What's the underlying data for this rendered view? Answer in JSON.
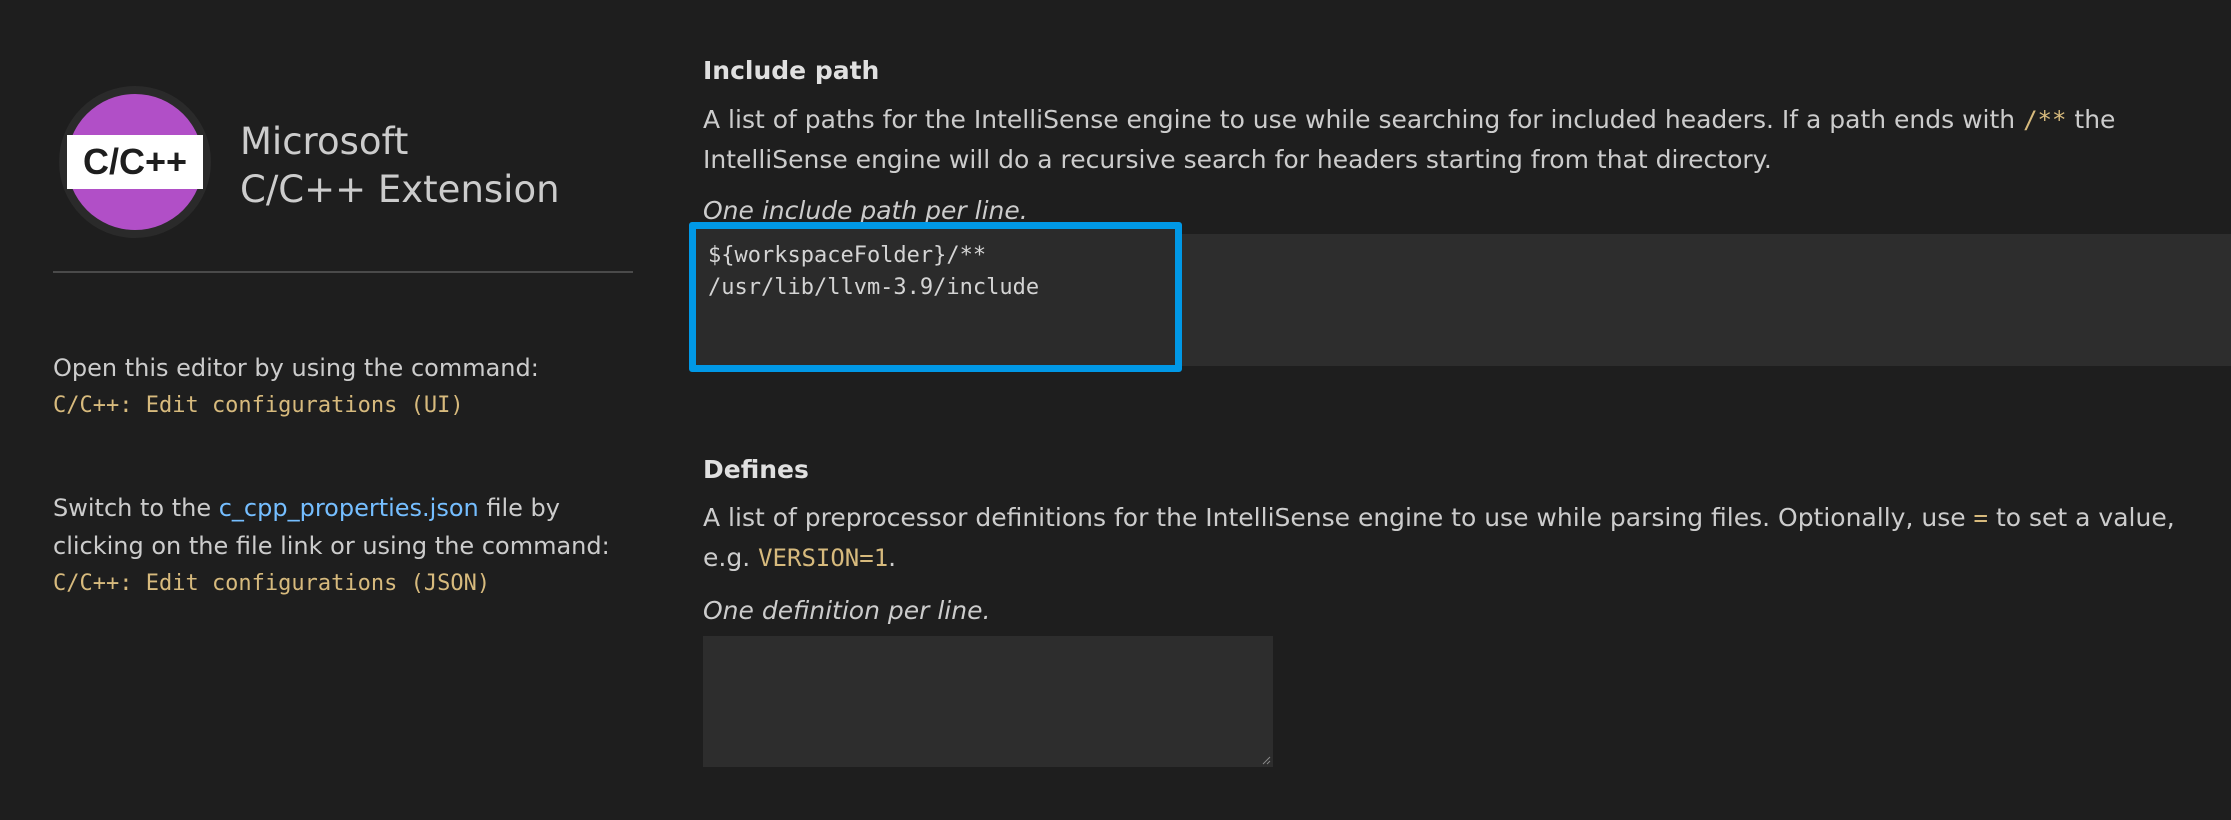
{
  "sidebar": {
    "logo_text": "C/C++",
    "title_line1": "Microsoft",
    "title_line2": "C/C++ Extension",
    "ui_hint_text": "Open this editor by using the command:",
    "ui_command": "C/C++: Edit configurations (UI)",
    "json_hint_prefix": "Switch to the ",
    "json_file_link": "c_cpp_properties.json",
    "json_hint_suffix": " file by",
    "json_hint_line2": "clicking on the file link or using the command:",
    "json_command": "C/C++: Edit configurations (JSON)"
  },
  "include_path": {
    "title": "Include path",
    "desc_part1": "A list of paths for the IntelliSense engine to use while searching for included headers. If a path ends with ",
    "desc_code": "/**",
    "desc_part2": " the IntelliSense engine will do a recursive search for headers starting from that directory.",
    "hint": "One include path per line.",
    "value": "${workspaceFolder}/**\n/usr/lib/llvm-3.9/include"
  },
  "defines": {
    "title": "Defines",
    "desc_part1": "A list of preprocessor definitions for the IntelliSense engine to use while parsing files. Optionally, use ",
    "desc_code1": "=",
    "desc_part2": " to set a value, e.g. ",
    "desc_code2": "VERSION=1",
    "desc_part3": ".",
    "hint": "One definition per line.",
    "value": ""
  },
  "colors": {
    "background": "#1e1e1e",
    "code_accent": "#d7ba7d",
    "link": "#75beff",
    "focus_border": "#0098e6",
    "logo_purple": "#b14fc7"
  }
}
